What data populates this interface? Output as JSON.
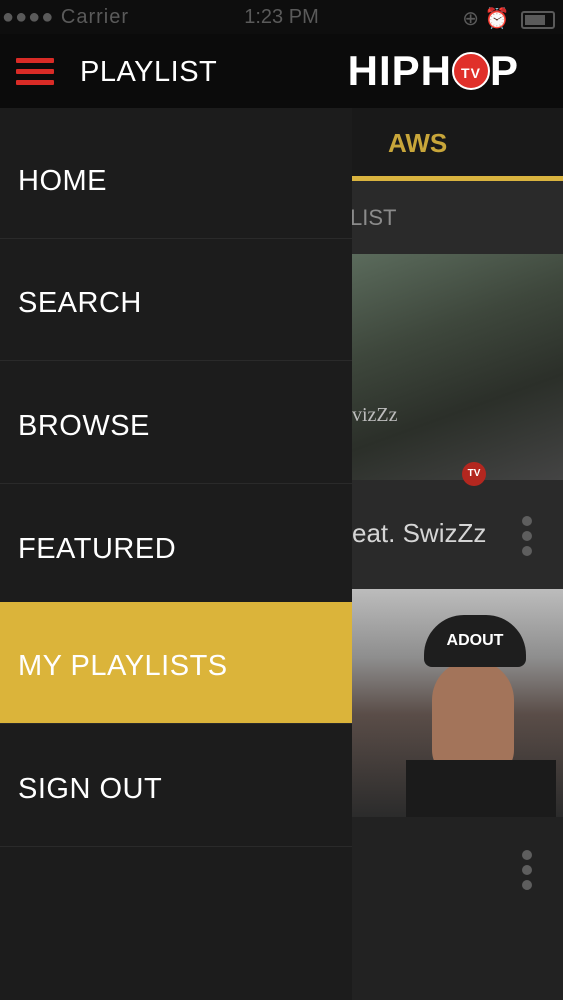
{
  "status_bar": {
    "carrier": "●●●● Carrier",
    "time": "1:23 PM",
    "right": "⊕ ⏰"
  },
  "header": {
    "title": "PLAYLIST",
    "logo_left": "HIPH",
    "logo_tv": "TV",
    "logo_right": "P"
  },
  "background": {
    "tab_label": "AWS",
    "section_label": "LIST",
    "video1_overlay_text": "vizZz",
    "video1_tv_badge": "TV",
    "video1_title": "eat. SwizZz",
    "video2_cap_text": "ADOUT"
  },
  "drawer": {
    "items": [
      {
        "label": "HOME"
      },
      {
        "label": "SEARCH"
      },
      {
        "label": "BROWSE"
      },
      {
        "label": "FEATURED"
      },
      {
        "label": "MY PLAYLISTS",
        "active": true
      },
      {
        "label": "SIGN OUT"
      }
    ]
  },
  "colors": {
    "accent": "#dbb43a",
    "brand_red": "#d92b26",
    "drawer_bg": "#1c1c1c",
    "header_bg": "#0b0b0b"
  }
}
